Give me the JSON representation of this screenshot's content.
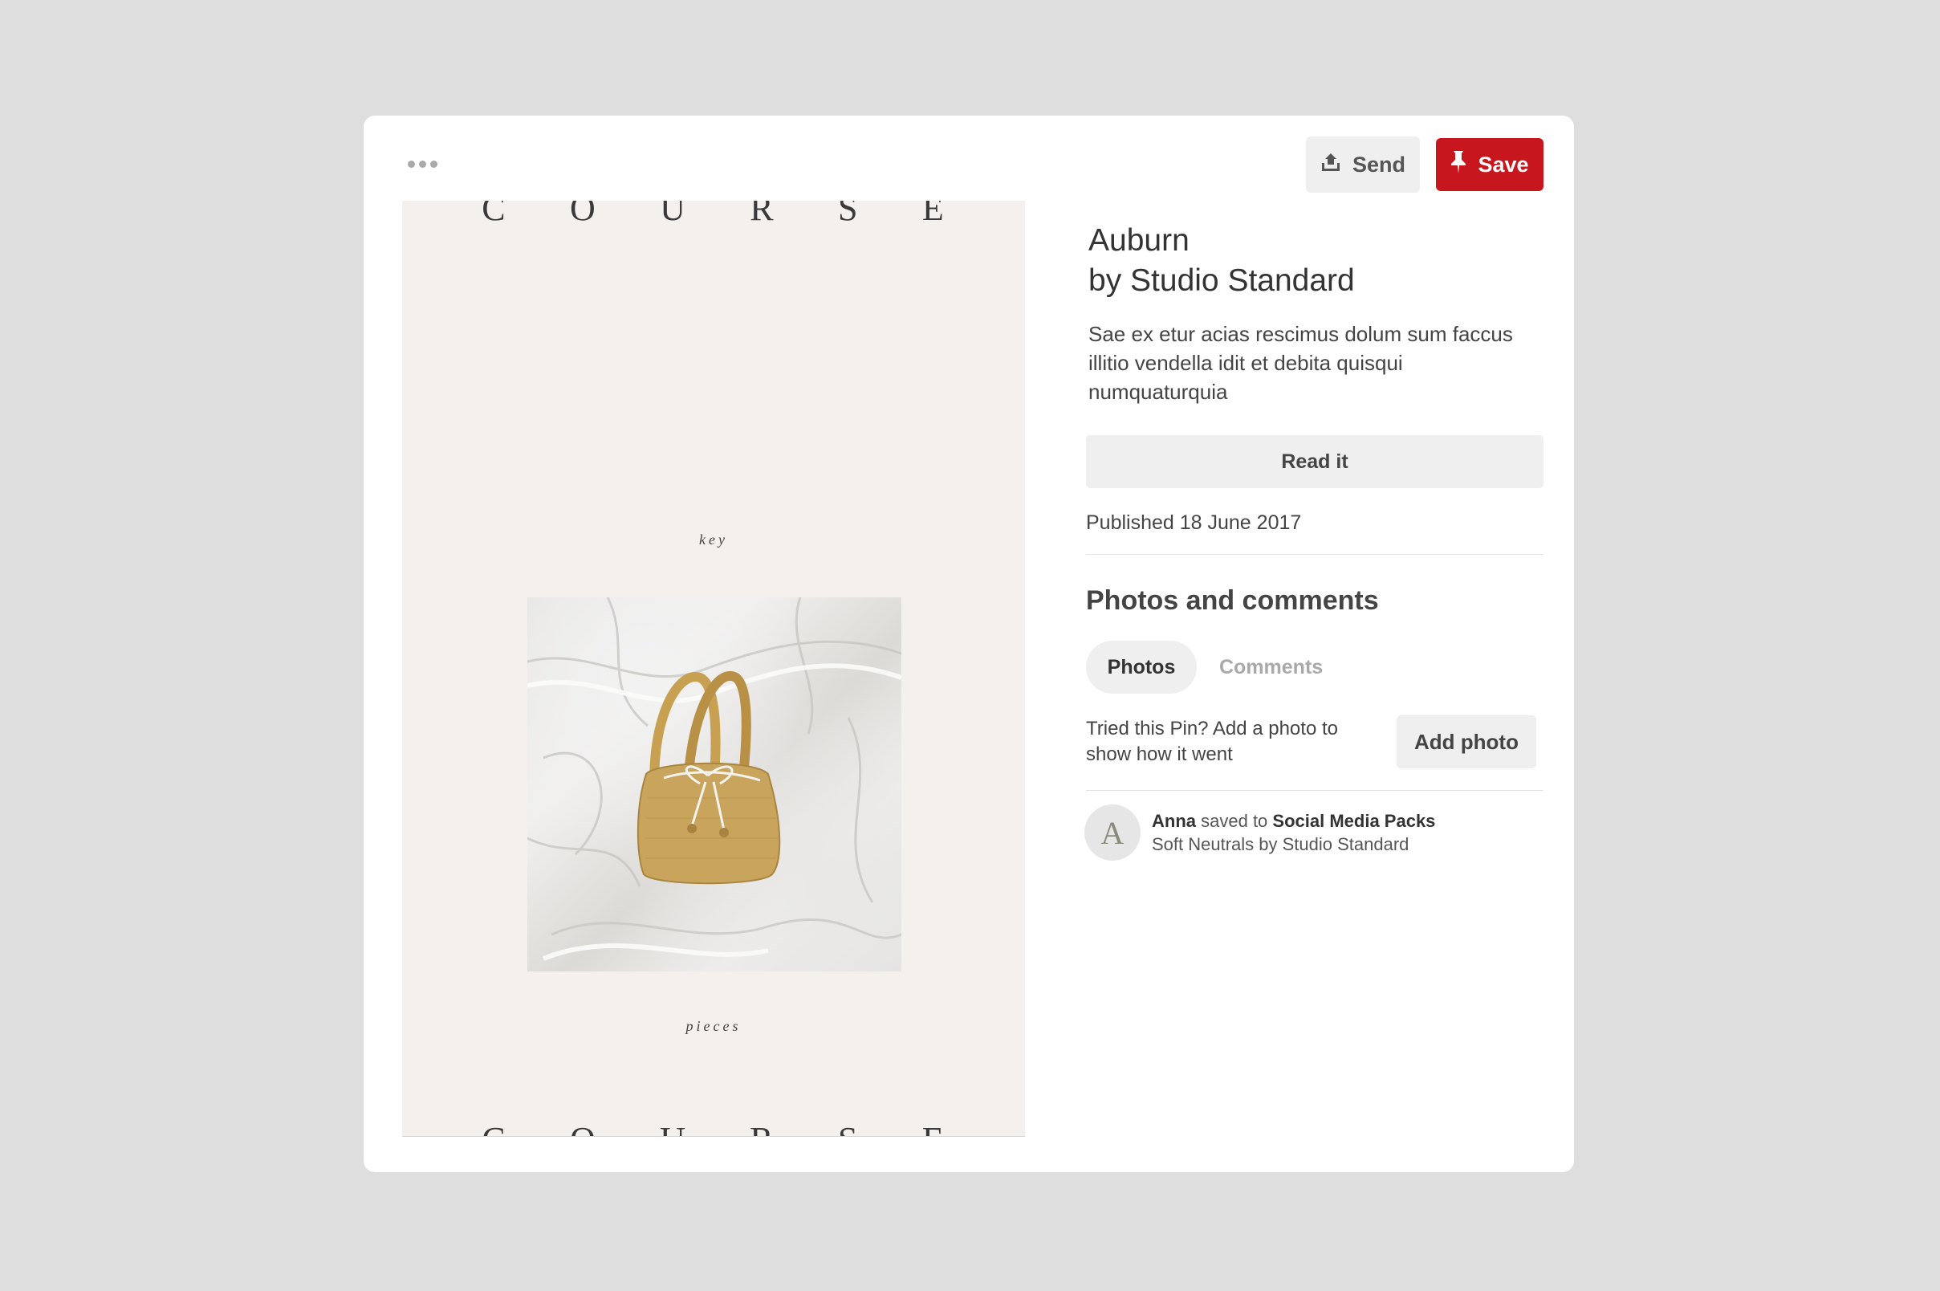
{
  "header": {
    "more_icon": "ellipsis-icon",
    "send_label": "Send",
    "send_icon": "share-upload-icon",
    "save_label": "Save",
    "save_icon": "pushpin-icon",
    "save_color": "#c8161e"
  },
  "pin_image": {
    "top_letters": [
      "C",
      "O",
      "U",
      "R",
      "S",
      "E"
    ],
    "bottom_letters": [
      "C",
      "O",
      "U",
      "R",
      "S",
      "E"
    ],
    "word_top": "key",
    "word_bottom": "pieces",
    "photo_subject": "woven straw bucket bag on white linen"
  },
  "details": {
    "title_line1": "Auburn",
    "title_line2": "by Studio Standard",
    "description": "Sae ex etur acias rescimus dolum sum faccus illitio vendella idit et debita quisqui numquaturquia",
    "read_button": "Read it",
    "published": "Published 18 June 2017"
  },
  "photos_comments": {
    "title": "Photos and comments",
    "tabs": [
      "Photos",
      "Comments"
    ],
    "prompt": "Tried this Pin? Add a photo to show how it went",
    "add_button": "Add photo"
  },
  "activity": {
    "avatar_letter": "A",
    "user": "Anna",
    "verb": "saved to",
    "board": "Social Media Packs",
    "subtitle": "Soft Neutrals by Studio Standard"
  }
}
